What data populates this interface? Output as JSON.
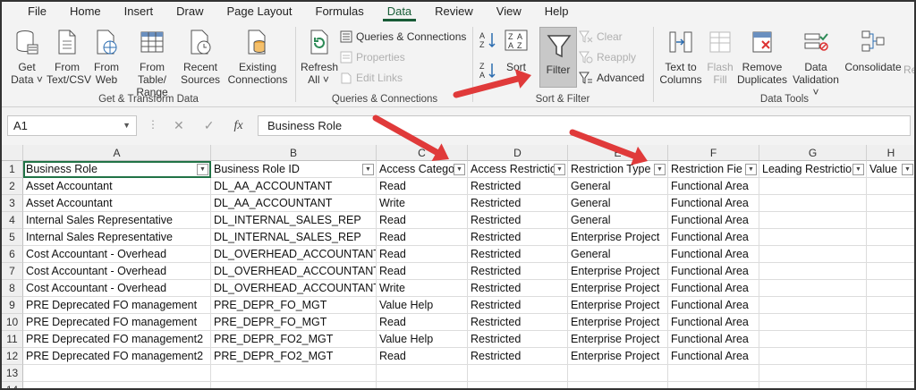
{
  "menu": [
    "File",
    "Home",
    "Insert",
    "Draw",
    "Page Layout",
    "Formulas",
    "Data",
    "Review",
    "View",
    "Help"
  ],
  "active_menu": "Data",
  "ribbon": {
    "get_transform": {
      "label": "Get & Transform Data",
      "get_data": [
        "Get",
        "Data ˅"
      ],
      "from_text": [
        "From",
        "Text/CSV"
      ],
      "from_web": [
        "From",
        "Web"
      ],
      "from_table": [
        "From Table/",
        "Range"
      ],
      "recent": [
        "Recent",
        "Sources"
      ],
      "existing": [
        "Existing",
        "Connections"
      ]
    },
    "queries": {
      "label": "Queries & Connections",
      "refresh": [
        "Refresh",
        "All ˅"
      ],
      "queries_connections": "Queries & Connections",
      "properties": "Properties",
      "edit_links": "Edit Links"
    },
    "sort_filter": {
      "label": "Sort & Filter",
      "sort": "Sort",
      "filter": "Filter",
      "clear": "Clear",
      "reapply": "Reapply",
      "advanced": "Advanced"
    },
    "data_tools": {
      "label": "Data Tools",
      "text_to_columns": [
        "Text to",
        "Columns"
      ],
      "flash_fill": [
        "Flash",
        "Fill"
      ],
      "remove_duplicates": [
        "Remove",
        "Duplicates"
      ],
      "data_validation": [
        "Data",
        "Validation ˅"
      ],
      "consolidate": "Consolidate",
      "re": "Re"
    }
  },
  "formula_bar": {
    "name_box": "A1",
    "formula": "Business Role"
  },
  "columns": [
    "A",
    "B",
    "C",
    "D",
    "E",
    "F",
    "G",
    "H"
  ],
  "rows": [
    [
      "Business Role",
      "Business Role ID",
      "Access Catego",
      "Access Restrictio",
      "Restriction Type",
      "Restriction Fie",
      "Leading Restrictio",
      "Value"
    ],
    [
      "Asset Accountant",
      "DL_AA_ACCOUNTANT",
      "Read",
      "Restricted",
      "General",
      "Functional Area",
      "",
      ""
    ],
    [
      "Asset Accountant",
      "DL_AA_ACCOUNTANT",
      "Write",
      "Restricted",
      "General",
      "Functional Area",
      "",
      ""
    ],
    [
      "Internal Sales Representative",
      "DL_INTERNAL_SALES_REP",
      "Read",
      "Restricted",
      "General",
      "Functional Area",
      "",
      ""
    ],
    [
      "Internal Sales Representative",
      "DL_INTERNAL_SALES_REP",
      "Read",
      "Restricted",
      "Enterprise Project",
      "Functional Area",
      "",
      ""
    ],
    [
      "Cost Accountant - Overhead",
      "DL_OVERHEAD_ACCOUNTANT",
      "Read",
      "Restricted",
      "General",
      "Functional Area",
      "",
      ""
    ],
    [
      "Cost Accountant - Overhead",
      "DL_OVERHEAD_ACCOUNTANT",
      "Read",
      "Restricted",
      "Enterprise Project",
      "Functional Area",
      "",
      ""
    ],
    [
      "Cost Accountant - Overhead",
      "DL_OVERHEAD_ACCOUNTANT",
      "Write",
      "Restricted",
      "Enterprise Project",
      "Functional Area",
      "",
      ""
    ],
    [
      "PRE Deprecated FO management",
      "PRE_DEPR_FO_MGT",
      "Value Help",
      "Restricted",
      "Enterprise Project",
      "Functional Area",
      "",
      ""
    ],
    [
      "PRE Deprecated FO management",
      "PRE_DEPR_FO_MGT",
      "Read",
      "Restricted",
      "Enterprise Project",
      "Functional Area",
      "",
      ""
    ],
    [
      "PRE Deprecated FO management2",
      "PRE_DEPR_FO2_MGT",
      "Value Help",
      "Restricted",
      "Enterprise Project",
      "Functional Area",
      "",
      ""
    ],
    [
      "PRE Deprecated FO management2",
      "PRE_DEPR_FO2_MGT",
      "Read",
      "Restricted",
      "Enterprise Project",
      "Functional Area",
      "",
      ""
    ],
    [
      "",
      "",
      "",
      "",
      "",
      "",
      "",
      ""
    ],
    [
      "",
      "",
      "",
      "",
      "",
      "",
      "",
      ""
    ]
  ],
  "row_numbers": [
    "1",
    "2",
    "3",
    "4",
    "5",
    "6",
    "7",
    "8",
    "9",
    "10",
    "11",
    "12",
    "13",
    "14"
  ],
  "accent_color": "#185c37",
  "annotation_color": "#e03a3a"
}
